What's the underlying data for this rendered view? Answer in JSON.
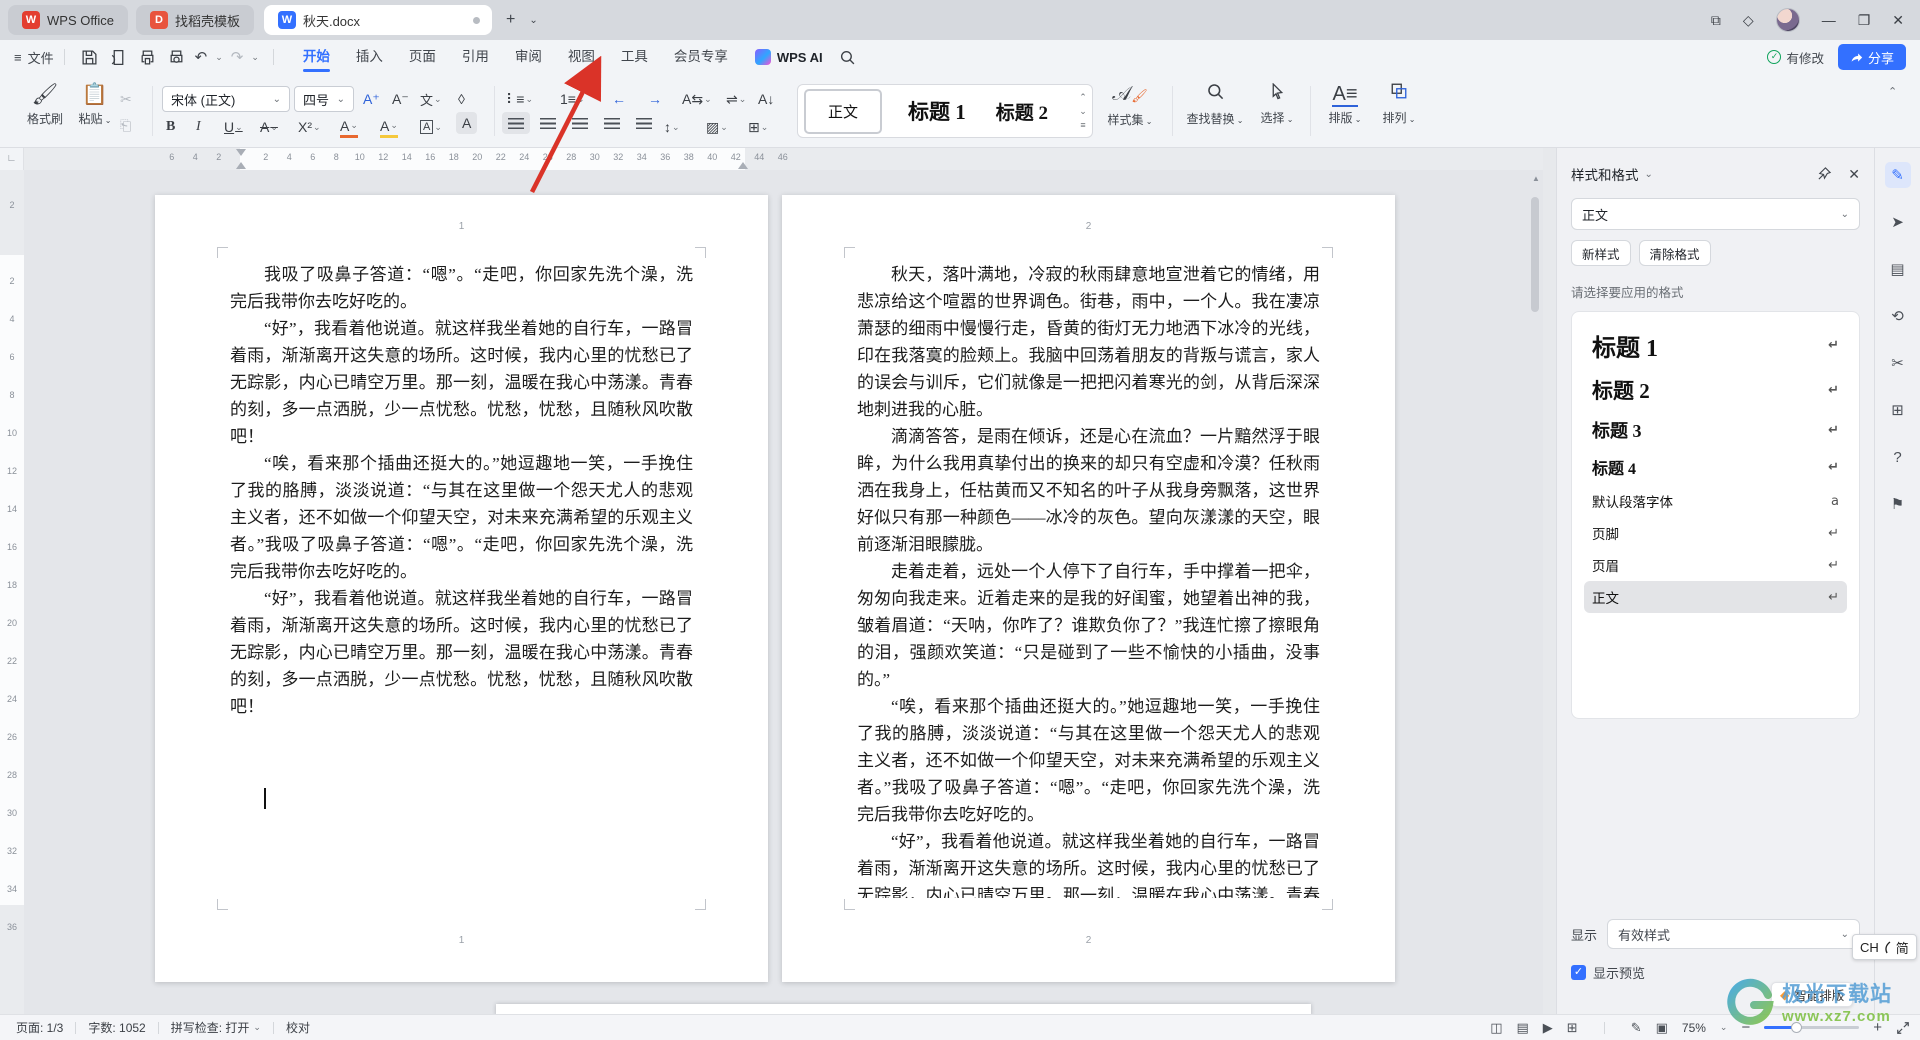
{
  "titlebar": {
    "tabs": [
      {
        "label": "WPS Office"
      },
      {
        "label": "找稻壳模板"
      },
      {
        "label": "秋天.docx"
      }
    ]
  },
  "menubar": {
    "file_label": "文件",
    "tabs": [
      "开始",
      "插入",
      "页面",
      "引用",
      "审阅",
      "视图",
      "工具",
      "会员专享"
    ],
    "active_tab": "开始",
    "wps_ai": "WPS AI",
    "modified_label": "有修改",
    "share_label": "分享"
  },
  "ribbon": {
    "format_painter": "格式刷",
    "paste": "粘贴",
    "font_name": "宋体 (正文)",
    "font_size": "四号",
    "style_chips": [
      "正文",
      "标题 1",
      "标题 2"
    ],
    "style_set": "样式集",
    "find_replace": "查找替换",
    "select": "选择",
    "layout": "排版",
    "arrange": "排列"
  },
  "icons": {
    "hamburger": "≡",
    "chevron_down": "⌄",
    "chevron_up": "⌃",
    "undo": "↶",
    "redo": "↷",
    "plus": "+",
    "minimize": "—",
    "restore": "❐",
    "close": "✕",
    "stack": "⧉",
    "cube": "◇",
    "dot": "●",
    "scissors": "✂",
    "eraser": "◊",
    "bold": "B",
    "italic": "I",
    "underline": "U",
    "strike": "A",
    "superscript": "X²",
    "font_color": "A",
    "highlight": "A",
    "char_border": "A",
    "char_shading": "A",
    "grow_font": "A⁺",
    "shrink_font": "A⁻",
    "phonetic": "文",
    "bullets": "⠇≡",
    "numbering": "1≡",
    "indent_less": "←",
    "indent_more": "→",
    "text_dir": "A⇆",
    "cjk_layout": "⇌",
    "sort": "A↓",
    "table_border": "▦",
    "line_spacing": "↕",
    "shading": "▨",
    "borders": "⊞",
    "pen": "✎",
    "cursor": "➤",
    "grid": "⊞",
    "history": "⟲",
    "cut": "✂",
    "panel": "▤",
    "help": "?",
    "flag": "⚑",
    "return_mark": "↵",
    "char_mark": "a",
    "drag_handle": "⠿",
    "corner_tab": "∟",
    "check": "✓"
  },
  "h_ruler": {
    "labels": [
      "6",
      "4",
      "2",
      "",
      "2",
      "4",
      "6",
      "8",
      "10",
      "12",
      "14",
      "16",
      "18",
      "20",
      "22",
      "24",
      "26",
      "28",
      "30",
      "32",
      "34",
      "36",
      "38",
      "40",
      "42",
      "44",
      "46"
    ]
  },
  "v_ruler": {
    "labels": [
      "2",
      "",
      "2",
      "4",
      "6",
      "8",
      "10",
      "12",
      "14",
      "16",
      "18",
      "20",
      "22",
      "24",
      "26",
      "28",
      "30",
      "32",
      "34",
      "36"
    ]
  },
  "document": {
    "pages": [
      {
        "header_number": "1",
        "footer_number": "1",
        "paragraphs": [
          "我吸了吸鼻子答道：“嗯”。“走吧，你回家先洗个澡，洗完后我带你去吃好吃的。",
          "“好”，我看着他说道。就这样我坐着她的自行车，一路冒着雨，渐渐离开这失意的场所。这时候，我内心里的忧愁已了无踪影，内心已晴空万里。那一刻，温暖在我心中荡漾。青春的刻，多一点洒脱，少一点忧愁。忧愁，忧愁，且随秋风吹散吧！",
          "“唉，看来那个插曲还挺大的。”她逗趣地一笑，一手挽住了我的胳膊，淡淡说道：“与其在这里做一个怨天尤人的悲观主义者，还不如做一个仰望天空，对未来充满希望的乐观主义者。”我吸了吸鼻子答道：“嗯”。“走吧，你回家先洗个澡，洗完后我带你去吃好吃的。",
          "“好”，我看着他说道。就这样我坐着她的自行车，一路冒着雨，渐渐离开这失意的场所。这时候，我内心里的忧愁已了无踪影，内心已晴空万里。那一刻，温暖在我心中荡漾。青春的刻，多一点洒脱，少一点忧愁。忧愁，忧愁，且随秋风吹散吧！"
        ]
      },
      {
        "header_number": "2",
        "footer_number": "2",
        "paragraphs": [
          "秋天，落叶满地，冷寂的秋雨肆意地宣泄着它的情绪，用悲凉给这个喧嚣的世界调色。街巷，雨中，一个人。我在凄凉萧瑟的细雨中慢慢行走，昏黄的街灯无力地洒下冰冷的光线，印在我落寞的脸颊上。我脑中回荡着朋友的背叛与谎言，家人的误会与训斥，它们就像是一把把闪着寒光的剑，从背后深深地刺进我的心脏。",
          "滴滴答答，是雨在倾诉，还是心在流血？一片黯然浮于眼眸，为什么我用真挚付出的换来的却只有空虚和冷漠？任秋雨洒在我身上，任枯黄而又不知名的叶子从我身旁飘落，这世界好似只有那一种颜色——冰冷的灰色。望向灰漾漾的天空，眼前逐渐泪眼朦胧。",
          "走着走着，远处一个人停下了自行车，手中撑着一把伞，匆匆向我走来。近着走来的是我的好闺蜜，她望着出神的我，皱着眉道：“天呐，你咋了？谁欺负你了？”我连忙擦了擦眼角的泪，强颜欢笑道：“只是碰到了一些不愉快的小插曲，没事的。”",
          "“唉，看来那个插曲还挺大的。”她逗趣地一笑，一手挽住了我的胳膊，淡淡说道：“与其在这里做一个怨天尤人的悲观主义者，还不如做一个仰望天空，对未来充满希望的乐观主义者。”我吸了吸鼻子答道：“嗯”。“走吧，你回家先洗个澡，洗完后我带你去吃好吃的。",
          "“好”，我看着他说道。就这样我坐着她的自行车，一路冒着雨，渐渐离开这失意的场所。这时候，我内心里的忧愁已了无踪影，内心已晴空万里。那一刻，温暖在我心中荡漾。青春的刻，多一点洒脱，少一点忧愁。忧愁，忧愁，且随秋风吹散吧！“唉，看来那个插曲还挺大的。”她逗趣地一笑，一手挽住了我的胳膊，淡淡说道：“与其在这里做一个怨天尤人的悲观主义者，还不如做一个仰望天空，对未来充满希望的乐观主义者。”"
        ]
      }
    ]
  },
  "sidebar": {
    "title": "样式和格式",
    "current_style": "正文",
    "new_style": "新样式",
    "clear_format": "清除格式",
    "hint": "请选择要应用的格式",
    "styles": [
      {
        "label": "标题 1"
      },
      {
        "label": "标题 2"
      },
      {
        "label": "标题 3"
      },
      {
        "label": "标题 4"
      },
      {
        "label": "默认段落字体"
      },
      {
        "label": "页脚"
      },
      {
        "label": "页眉"
      },
      {
        "label": "正文"
      }
    ],
    "show_label": "显示",
    "show_value": "有效样式",
    "preview_label": "显示预览",
    "smart_layout": "智能排版"
  },
  "statusbar": {
    "page": "页面: 1/3",
    "words": "字数: 1052",
    "spellcheck": "拼写检查: 打开",
    "proof": "校对",
    "zoom": "75%"
  },
  "ime": {
    "lang": "CH",
    "script": "简"
  },
  "watermark": {
    "name": "极光下载站",
    "url": "www.xz7.com"
  }
}
